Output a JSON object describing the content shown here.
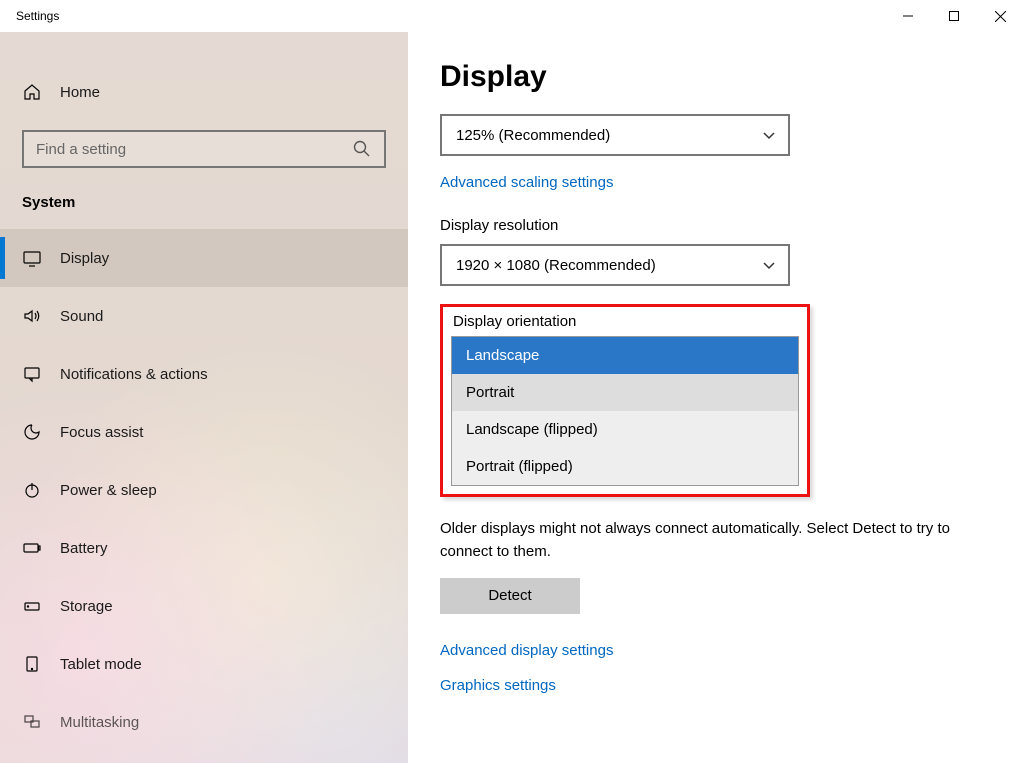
{
  "window": {
    "title": "Settings"
  },
  "sidebar": {
    "home_label": "Home",
    "search_placeholder": "Find a setting",
    "category": "System",
    "items": [
      {
        "label": "Display",
        "selected": true
      },
      {
        "label": "Sound"
      },
      {
        "label": "Notifications & actions"
      },
      {
        "label": "Focus assist"
      },
      {
        "label": "Power & sleep"
      },
      {
        "label": "Battery"
      },
      {
        "label": "Storage"
      },
      {
        "label": "Tablet mode"
      },
      {
        "label": "Multitasking"
      }
    ]
  },
  "main": {
    "title": "Display",
    "scale": {
      "value": "125% (Recommended)"
    },
    "scale_link": "Advanced scaling settings",
    "resolution_label": "Display resolution",
    "resolution": {
      "value": "1920 × 1080 (Recommended)"
    },
    "orientation_label": "Display orientation",
    "orientation_options": [
      {
        "label": "Landscape",
        "selected": true
      },
      {
        "label": "Portrait",
        "hover": true
      },
      {
        "label": "Landscape (flipped)"
      },
      {
        "label": "Portrait (flipped)"
      }
    ],
    "detect_note": "Older displays might not always connect automatically. Select Detect to try to connect to them.",
    "detect_button": "Detect",
    "advanced_link": "Advanced display settings",
    "graphics_link": "Graphics settings"
  }
}
